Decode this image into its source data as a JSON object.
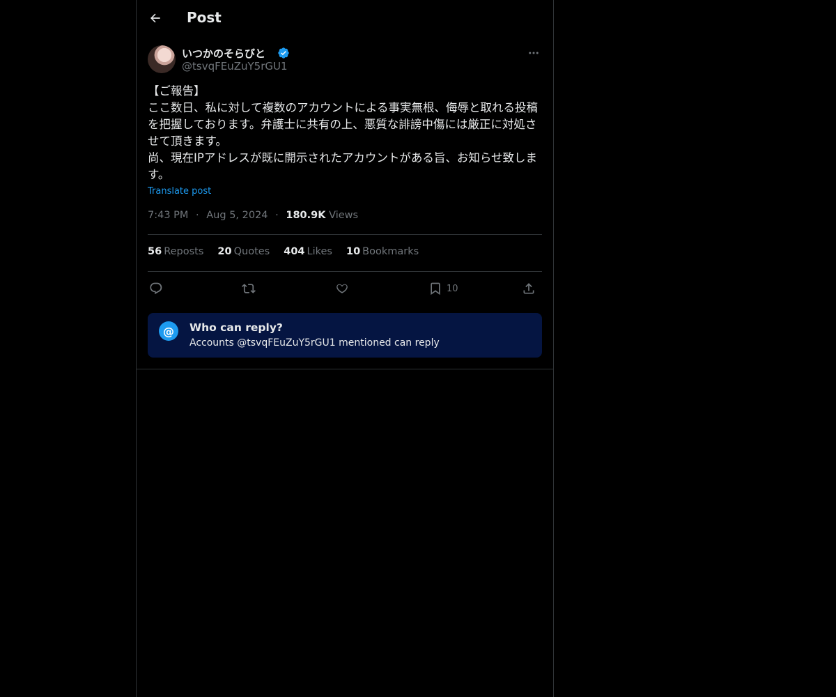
{
  "header": {
    "title": "Post",
    "back_icon": "arrow-left-icon"
  },
  "author": {
    "name": "いつかのそらびと",
    "handle": "@tsvqFEuZuY5rGU1",
    "verified": true,
    "verified_color": "#1d9bf0"
  },
  "post": {
    "text": "【ご報告】\nここ数日、私に対して複数のアカウントによる事実無根、侮辱と取れる投稿を把握しております。弁護士に共有の上、悪質な誹謗中傷には厳正に対処させて頂きます。\n尚、現在IPアドレスが既に開示されたアカウントがある旨、お知らせ致します。",
    "translate_label": "Translate post",
    "time": "7:43 PM",
    "separator": "·",
    "date": "Aug 5, 2024",
    "views_count": "180.9K",
    "views_label": "Views"
  },
  "stats": [
    {
      "count": "56",
      "label": "Reposts"
    },
    {
      "count": "20",
      "label": "Quotes"
    },
    {
      "count": "404",
      "label": "Likes"
    },
    {
      "count": "10",
      "label": "Bookmarks"
    }
  ],
  "actions": {
    "reply_icon": "reply-icon",
    "repost_icon": "repost-icon",
    "like_icon": "heart-icon",
    "bookmark_icon": "bookmark-icon",
    "bookmark_count": "10",
    "share_icon": "share-icon"
  },
  "reply_restriction": {
    "icon_text": "@",
    "title": "Who can reply?",
    "subtitle": "Accounts @tsvqFEuZuY5rGU1 mentioned can reply"
  },
  "colors": {
    "background": "#000000",
    "text_primary": "#e7e9ea",
    "text_secondary": "#71767b",
    "accent": "#1d9bf0",
    "border": "#2f3336",
    "reply_box_bg": "#051542"
  }
}
